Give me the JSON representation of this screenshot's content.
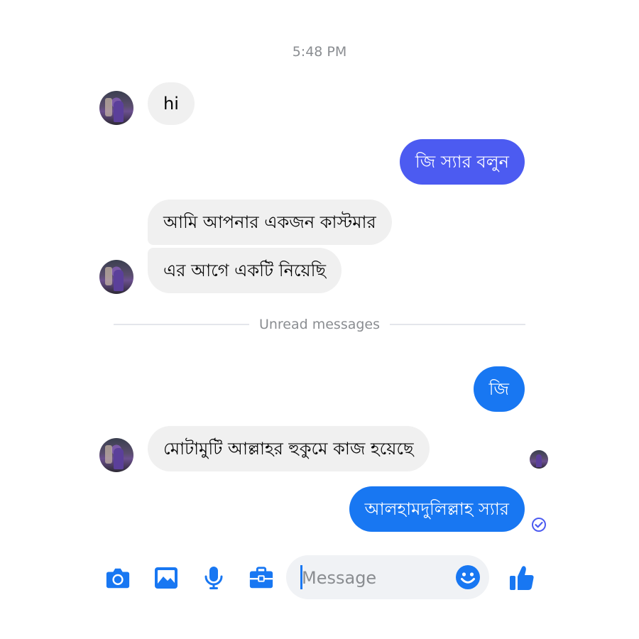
{
  "thread": {
    "timestamp": "5:48 PM",
    "divider_label": "Unread messages"
  },
  "messages": [
    {
      "side": "in",
      "text": "hi"
    },
    {
      "side": "out",
      "text": "জি স্যার বলুন"
    },
    {
      "side": "in",
      "text": "আমি আপনার একজন কাস্টমার"
    },
    {
      "side": "in",
      "text": "এর আগে একটি নিয়েছি"
    },
    {
      "side": "out",
      "text": "জি"
    },
    {
      "side": "in",
      "text": "মোটামুটি আল্লাহর হুকুমে কাজ হয়েছে"
    },
    {
      "side": "out",
      "text": "আলহামদুলিল্লাহ স্যার"
    }
  ],
  "composer": {
    "placeholder": "Message",
    "value": ""
  },
  "icons": {
    "camera": "camera-icon",
    "gallery": "image-icon",
    "mic": "microphone-icon",
    "more": "briefcase-icon",
    "emoji": "smiley-icon",
    "like": "thumbs-up-icon",
    "seen": "check-circle-icon"
  },
  "colors": {
    "accent_blue": "#1877f2",
    "accent_purple": "#4c5bf1",
    "incoming_bubble": "#f0f0f0",
    "meta_text": "#8a8d91"
  }
}
